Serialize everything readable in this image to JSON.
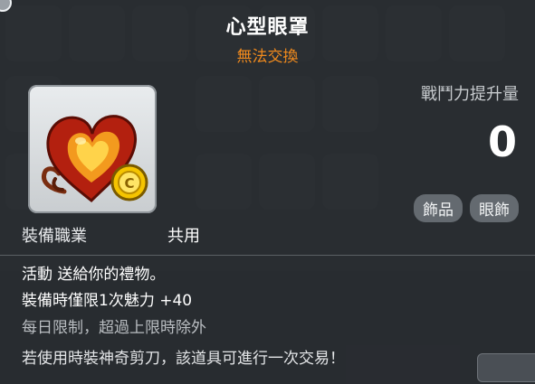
{
  "tooltip": {
    "title": "心型眼罩",
    "trade_status": "無法交換",
    "item_icon": "heart-eye-mask-icon",
    "combat_power": {
      "label": "戰鬥力提升量",
      "value": "0"
    },
    "tags": [
      "飾品",
      "眼飾"
    ],
    "job": {
      "label": "裝備職業",
      "value": "共用"
    },
    "description": [
      "活動 送給你的禮物。",
      "裝備時僅限1次魅力  +40",
      "每日限制，超過上限時除外",
      "若使用時裝神奇剪刀，該道具可進行一次交易！"
    ]
  },
  "colors": {
    "title": "#ffffff",
    "trade_status": "#f08a1d",
    "limit_text": "#b9bdc1",
    "tag_background": "#646a70"
  }
}
